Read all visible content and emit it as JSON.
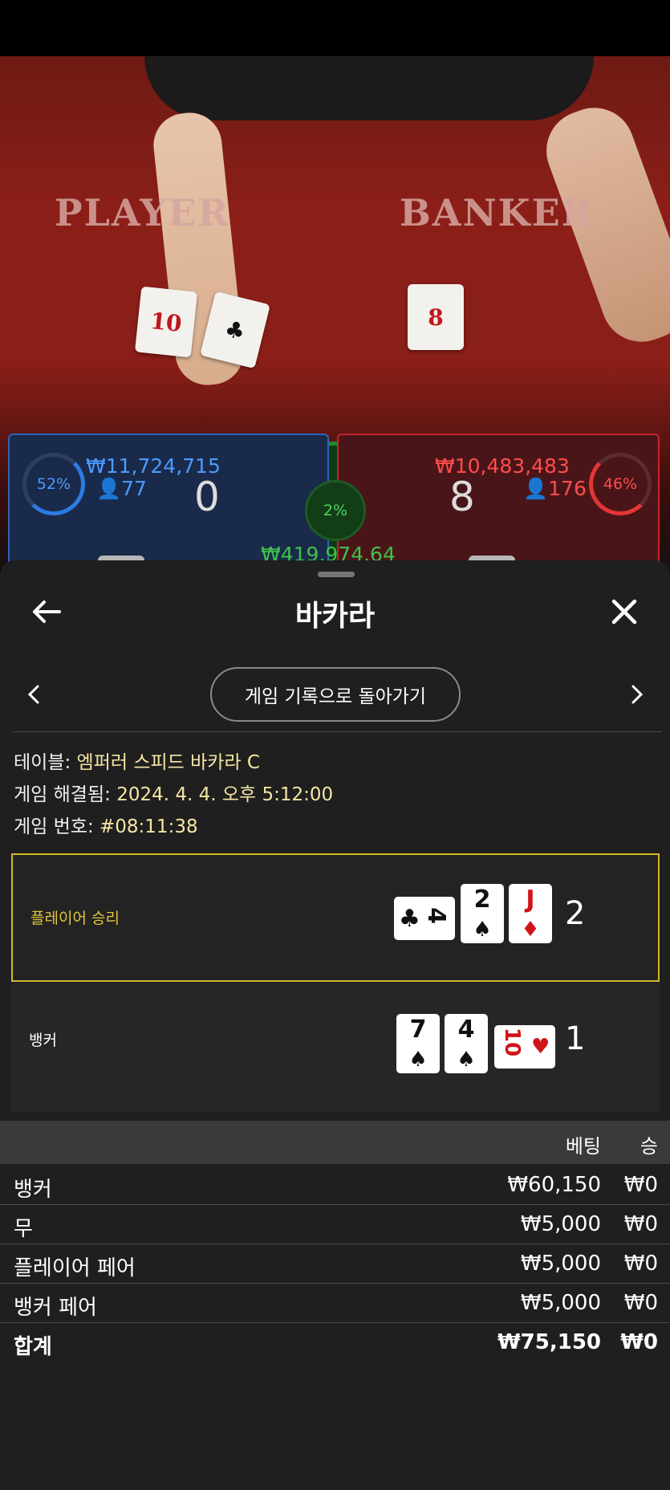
{
  "colors": {
    "accent_gold": "#d4b82a",
    "player_blue": "#2c7be5",
    "banker_red": "#e53636",
    "center_green": "#1f8a2f"
  },
  "live": {
    "table_player": "PLAYER",
    "table_banker": "BANKER",
    "player_card_1": "10",
    "banker_card_1": "8",
    "player_pct": "52%",
    "player_amount": "₩11,724,715",
    "player_count": "77",
    "player_score": "0",
    "tie_pct": "2%",
    "tie_amount": "₩419,974.64",
    "banker_pct": "46%",
    "banker_amount": "₩10,483,483",
    "banker_count": "176",
    "banker_score": "8"
  },
  "sheet": {
    "title": "바카라",
    "back_icon": "arrow-left-icon",
    "close_icon": "close-icon",
    "back_to_history": "게임 기록으로 돌아가기",
    "info": {
      "table_label": "테이블:",
      "table_value": "엠퍼러 스피드 바카라 C",
      "resolved_label": "게임 해결됨:",
      "resolved_value": "2024. 4. 4. 오후 5:12:00",
      "number_label": "게임 번호:",
      "number_value": "#08:11:38"
    },
    "result_player": {
      "label": "플레이어 승리",
      "total": "2",
      "cards": [
        {
          "rank": "4",
          "suit": "♣",
          "color": "black"
        },
        {
          "rank": "2",
          "suit": "♠",
          "color": "black"
        },
        {
          "rank": "J",
          "suit": "♦",
          "color": "red"
        }
      ]
    },
    "result_banker": {
      "label": "뱅커",
      "total": "1",
      "cards": [
        {
          "rank": "7",
          "suit": "♠",
          "color": "black"
        },
        {
          "rank": "4",
          "suit": "♠",
          "color": "black"
        },
        {
          "rank": "10",
          "suit": "♥",
          "color": "red"
        }
      ]
    },
    "bets": {
      "header_bet": "베팅",
      "header_win": "승",
      "rows": [
        {
          "name": "뱅커",
          "bet": "₩60,150",
          "win": "₩0"
        },
        {
          "name": "무",
          "bet": "₩5,000",
          "win": "₩0"
        },
        {
          "name": "플레이어 페어",
          "bet": "₩5,000",
          "win": "₩0"
        },
        {
          "name": "뱅커 페어",
          "bet": "₩5,000",
          "win": "₩0"
        }
      ],
      "total": {
        "name": "합계",
        "bet": "₩75,150",
        "win": "₩0"
      }
    }
  }
}
